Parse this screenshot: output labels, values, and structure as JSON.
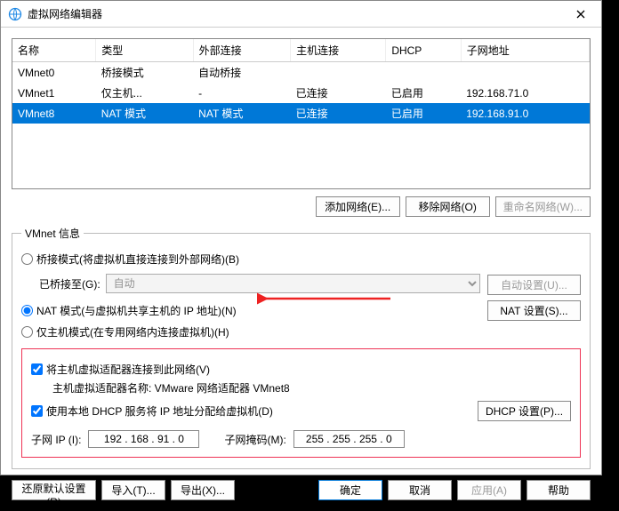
{
  "window": {
    "title": "虚拟网络编辑器"
  },
  "table": {
    "headers": [
      "名称",
      "类型",
      "外部连接",
      "主机连接",
      "DHCP",
      "子网地址"
    ],
    "rows": [
      {
        "name": "VMnet0",
        "type": "桥接模式",
        "ext": "自动桥接",
        "host": "",
        "dhcp": "",
        "subnet": ""
      },
      {
        "name": "VMnet1",
        "type": "仅主机...",
        "ext": "-",
        "host": "已连接",
        "dhcp": "已启用",
        "subnet": "192.168.71.0"
      },
      {
        "name": "VMnet8",
        "type": "NAT 模式",
        "ext": "NAT 模式",
        "host": "已连接",
        "dhcp": "已启用",
        "subnet": "192.168.91.0"
      }
    ]
  },
  "buttons": {
    "add_net": "添加网络(E)...",
    "remove_net": "移除网络(O)",
    "rename_net": "重命名网络(W)...",
    "auto_set": "自动设置(U)...",
    "nat_set": "NAT 设置(S)...",
    "dhcp_set": "DHCP 设置(P)...",
    "restore": "还原默认设置(R)",
    "import": "导入(T)...",
    "export": "导出(X)...",
    "ok": "确定",
    "cancel": "取消",
    "apply": "应用(A)",
    "help": "帮助"
  },
  "fieldset": {
    "legend": "VMnet 信息",
    "radio_bridge": "桥接模式(将虚拟机直接连接到外部网络)(B)",
    "bridge_to_label": "已桥接至(G):",
    "bridge_to_value": "自动",
    "radio_nat": "NAT 模式(与虚拟机共享主机的 IP 地址)(N)",
    "radio_host": "仅主机模式(在专用网络内连接虚拟机)(H)"
  },
  "check": {
    "connect_host": "将主机虚拟适配器连接到此网络(V)",
    "adapter_label": "主机虚拟适配器名称: VMware 网络适配器 VMnet8",
    "use_dhcp": "使用本地 DHCP 服务将 IP 地址分配给虚拟机(D)"
  },
  "ip": {
    "subnet_label": "子网 IP (I):",
    "subnet_value": "192 . 168 . 91 . 0",
    "mask_label": "子网掩码(M):",
    "mask_value": "255 . 255 . 255 . 0"
  }
}
